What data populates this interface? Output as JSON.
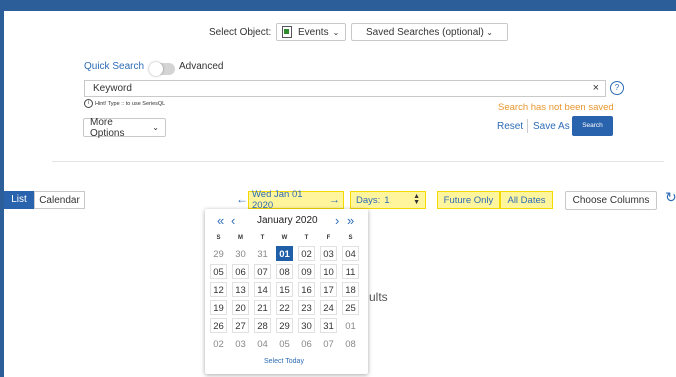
{
  "toolbar": {
    "select_object_label": "Select Object:",
    "object_value": "Events",
    "saved_searches_label": "Saved Searches (optional)"
  },
  "search": {
    "quick_search_label": "Quick Search",
    "advanced_label": "Advanced",
    "keyword_value": "Keyword",
    "hint": "Hint! Type :: to use SeriesQL",
    "not_saved_msg": "Search has not been saved",
    "more_options_label": "More Options",
    "reset_label": "Reset",
    "save_as_label": "Save As",
    "search_button_label": "Search"
  },
  "view": {
    "list_tab": "List",
    "calendar_tab": "Calendar",
    "date_label": "Wed Jan 01 2020",
    "days_label": "Days:",
    "days_value": "1",
    "future_only_label": "Future Only",
    "all_dates_label": "All Dates",
    "choose_columns_label": "Choose Columns",
    "results_partial": "ults"
  },
  "calendar": {
    "month_label": "January 2020",
    "dow": [
      "S",
      "M",
      "T",
      "W",
      "T",
      "F",
      "S"
    ],
    "weeks": [
      [
        "29",
        "30",
        "31",
        "01",
        "02",
        "03",
        "04"
      ],
      [
        "05",
        "06",
        "07",
        "08",
        "09",
        "10",
        "11"
      ],
      [
        "12",
        "13",
        "14",
        "15",
        "16",
        "17",
        "18"
      ],
      [
        "19",
        "20",
        "21",
        "22",
        "23",
        "24",
        "25"
      ],
      [
        "26",
        "27",
        "28",
        "29",
        "30",
        "31",
        "01"
      ],
      [
        "02",
        "03",
        "04",
        "05",
        "06",
        "07",
        "08"
      ]
    ],
    "select_today_label": "Select Today"
  },
  "colors": {
    "header_bg": "#2c5f99",
    "accent": "#2d6cb5",
    "selected_day": "#1f5fa8",
    "highlight": "#fff59d",
    "warning_text": "#e8962e"
  }
}
